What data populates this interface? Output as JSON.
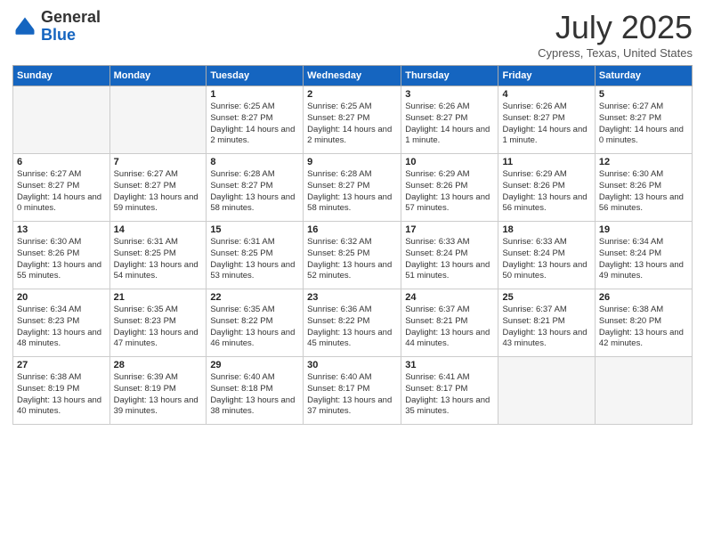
{
  "header": {
    "logo_general": "General",
    "logo_blue": "Blue",
    "month_title": "July 2025",
    "subtitle": "Cypress, Texas, United States"
  },
  "weekdays": [
    "Sunday",
    "Monday",
    "Tuesday",
    "Wednesday",
    "Thursday",
    "Friday",
    "Saturday"
  ],
  "weeks": [
    [
      {
        "day": "",
        "sunrise": "",
        "sunset": "",
        "daylight": ""
      },
      {
        "day": "",
        "sunrise": "",
        "sunset": "",
        "daylight": ""
      },
      {
        "day": "1",
        "sunrise": "Sunrise: 6:25 AM",
        "sunset": "Sunset: 8:27 PM",
        "daylight": "Daylight: 14 hours and 2 minutes."
      },
      {
        "day": "2",
        "sunrise": "Sunrise: 6:25 AM",
        "sunset": "Sunset: 8:27 PM",
        "daylight": "Daylight: 14 hours and 2 minutes."
      },
      {
        "day": "3",
        "sunrise": "Sunrise: 6:26 AM",
        "sunset": "Sunset: 8:27 PM",
        "daylight": "Daylight: 14 hours and 1 minute."
      },
      {
        "day": "4",
        "sunrise": "Sunrise: 6:26 AM",
        "sunset": "Sunset: 8:27 PM",
        "daylight": "Daylight: 14 hours and 1 minute."
      },
      {
        "day": "5",
        "sunrise": "Sunrise: 6:27 AM",
        "sunset": "Sunset: 8:27 PM",
        "daylight": "Daylight: 14 hours and 0 minutes."
      }
    ],
    [
      {
        "day": "6",
        "sunrise": "Sunrise: 6:27 AM",
        "sunset": "Sunset: 8:27 PM",
        "daylight": "Daylight: 14 hours and 0 minutes."
      },
      {
        "day": "7",
        "sunrise": "Sunrise: 6:27 AM",
        "sunset": "Sunset: 8:27 PM",
        "daylight": "Daylight: 13 hours and 59 minutes."
      },
      {
        "day": "8",
        "sunrise": "Sunrise: 6:28 AM",
        "sunset": "Sunset: 8:27 PM",
        "daylight": "Daylight: 13 hours and 58 minutes."
      },
      {
        "day": "9",
        "sunrise": "Sunrise: 6:28 AM",
        "sunset": "Sunset: 8:27 PM",
        "daylight": "Daylight: 13 hours and 58 minutes."
      },
      {
        "day": "10",
        "sunrise": "Sunrise: 6:29 AM",
        "sunset": "Sunset: 8:26 PM",
        "daylight": "Daylight: 13 hours and 57 minutes."
      },
      {
        "day": "11",
        "sunrise": "Sunrise: 6:29 AM",
        "sunset": "Sunset: 8:26 PM",
        "daylight": "Daylight: 13 hours and 56 minutes."
      },
      {
        "day": "12",
        "sunrise": "Sunrise: 6:30 AM",
        "sunset": "Sunset: 8:26 PM",
        "daylight": "Daylight: 13 hours and 56 minutes."
      }
    ],
    [
      {
        "day": "13",
        "sunrise": "Sunrise: 6:30 AM",
        "sunset": "Sunset: 8:26 PM",
        "daylight": "Daylight: 13 hours and 55 minutes."
      },
      {
        "day": "14",
        "sunrise": "Sunrise: 6:31 AM",
        "sunset": "Sunset: 8:25 PM",
        "daylight": "Daylight: 13 hours and 54 minutes."
      },
      {
        "day": "15",
        "sunrise": "Sunrise: 6:31 AM",
        "sunset": "Sunset: 8:25 PM",
        "daylight": "Daylight: 13 hours and 53 minutes."
      },
      {
        "day": "16",
        "sunrise": "Sunrise: 6:32 AM",
        "sunset": "Sunset: 8:25 PM",
        "daylight": "Daylight: 13 hours and 52 minutes."
      },
      {
        "day": "17",
        "sunrise": "Sunrise: 6:33 AM",
        "sunset": "Sunset: 8:24 PM",
        "daylight": "Daylight: 13 hours and 51 minutes."
      },
      {
        "day": "18",
        "sunrise": "Sunrise: 6:33 AM",
        "sunset": "Sunset: 8:24 PM",
        "daylight": "Daylight: 13 hours and 50 minutes."
      },
      {
        "day": "19",
        "sunrise": "Sunrise: 6:34 AM",
        "sunset": "Sunset: 8:24 PM",
        "daylight": "Daylight: 13 hours and 49 minutes."
      }
    ],
    [
      {
        "day": "20",
        "sunrise": "Sunrise: 6:34 AM",
        "sunset": "Sunset: 8:23 PM",
        "daylight": "Daylight: 13 hours and 48 minutes."
      },
      {
        "day": "21",
        "sunrise": "Sunrise: 6:35 AM",
        "sunset": "Sunset: 8:23 PM",
        "daylight": "Daylight: 13 hours and 47 minutes."
      },
      {
        "day": "22",
        "sunrise": "Sunrise: 6:35 AM",
        "sunset": "Sunset: 8:22 PM",
        "daylight": "Daylight: 13 hours and 46 minutes."
      },
      {
        "day": "23",
        "sunrise": "Sunrise: 6:36 AM",
        "sunset": "Sunset: 8:22 PM",
        "daylight": "Daylight: 13 hours and 45 minutes."
      },
      {
        "day": "24",
        "sunrise": "Sunrise: 6:37 AM",
        "sunset": "Sunset: 8:21 PM",
        "daylight": "Daylight: 13 hours and 44 minutes."
      },
      {
        "day": "25",
        "sunrise": "Sunrise: 6:37 AM",
        "sunset": "Sunset: 8:21 PM",
        "daylight": "Daylight: 13 hours and 43 minutes."
      },
      {
        "day": "26",
        "sunrise": "Sunrise: 6:38 AM",
        "sunset": "Sunset: 8:20 PM",
        "daylight": "Daylight: 13 hours and 42 minutes."
      }
    ],
    [
      {
        "day": "27",
        "sunrise": "Sunrise: 6:38 AM",
        "sunset": "Sunset: 8:19 PM",
        "daylight": "Daylight: 13 hours and 40 minutes."
      },
      {
        "day": "28",
        "sunrise": "Sunrise: 6:39 AM",
        "sunset": "Sunset: 8:19 PM",
        "daylight": "Daylight: 13 hours and 39 minutes."
      },
      {
        "day": "29",
        "sunrise": "Sunrise: 6:40 AM",
        "sunset": "Sunset: 8:18 PM",
        "daylight": "Daylight: 13 hours and 38 minutes."
      },
      {
        "day": "30",
        "sunrise": "Sunrise: 6:40 AM",
        "sunset": "Sunset: 8:17 PM",
        "daylight": "Daylight: 13 hours and 37 minutes."
      },
      {
        "day": "31",
        "sunrise": "Sunrise: 6:41 AM",
        "sunset": "Sunset: 8:17 PM",
        "daylight": "Daylight: 13 hours and 35 minutes."
      },
      {
        "day": "",
        "sunrise": "",
        "sunset": "",
        "daylight": ""
      },
      {
        "day": "",
        "sunrise": "",
        "sunset": "",
        "daylight": ""
      }
    ]
  ]
}
